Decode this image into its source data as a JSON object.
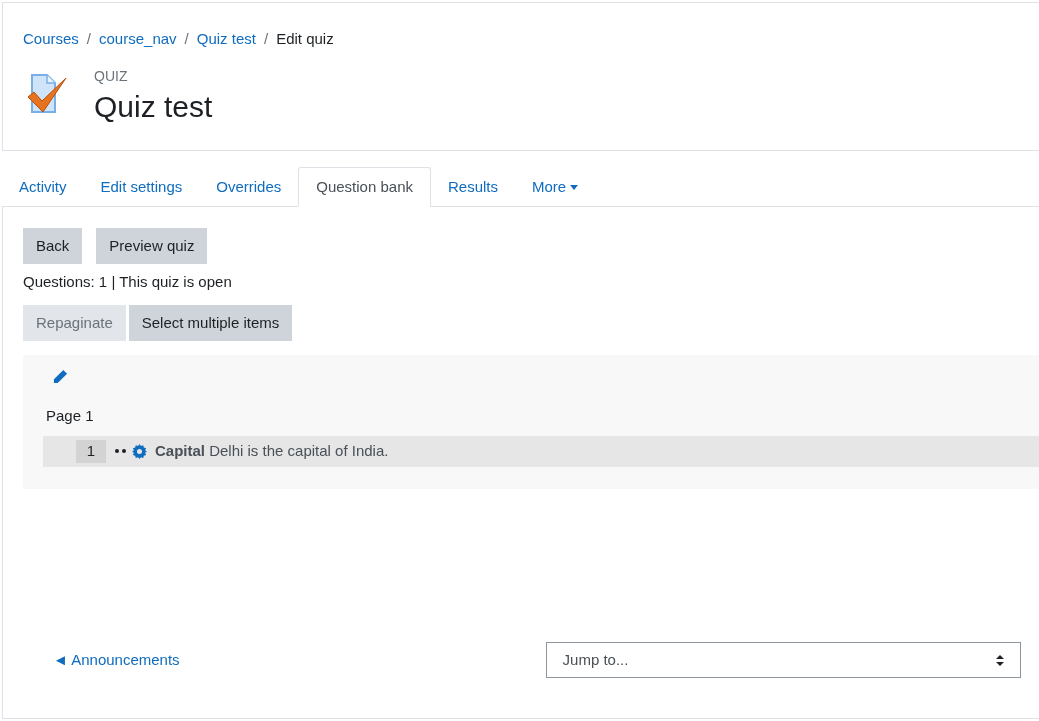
{
  "breadcrumb": [
    {
      "label": "Courses",
      "link": true
    },
    {
      "separator": "/"
    },
    {
      "label": "course_nav",
      "link": true
    },
    {
      "separator": "/"
    },
    {
      "label": "Quiz test",
      "link": true
    },
    {
      "separator": "/"
    },
    {
      "label": "Edit quiz",
      "link": false
    }
  ],
  "header": {
    "kicker": "QUIZ",
    "title": "Quiz test"
  },
  "tabs": [
    {
      "label": "Activity",
      "selected": false
    },
    {
      "label": "Edit settings",
      "selected": false
    },
    {
      "label": "Overrides",
      "selected": false
    },
    {
      "label": "Question bank",
      "selected": true
    },
    {
      "label": "Results",
      "selected": false
    },
    {
      "label": "More",
      "selected": false,
      "dropdown": true
    }
  ],
  "top_buttons": [
    {
      "label": "Back",
      "disabled": false
    },
    {
      "label": "Preview quiz",
      "disabled": false
    }
  ],
  "status": "Questions: 1 | This quiz is open",
  "action_buttons": [
    {
      "label": "Repaginate",
      "disabled": true
    },
    {
      "label": "Select multiple items",
      "disabled": false
    }
  ],
  "section": {
    "page_label": "Page 1",
    "questions": [
      {
        "number": "1",
        "text": "**Capital** Delhi is the capital of India."
      }
    ]
  },
  "footer": {
    "prev_link": "◄ Announcements",
    "jump_placeholder": "Jump to..."
  }
}
